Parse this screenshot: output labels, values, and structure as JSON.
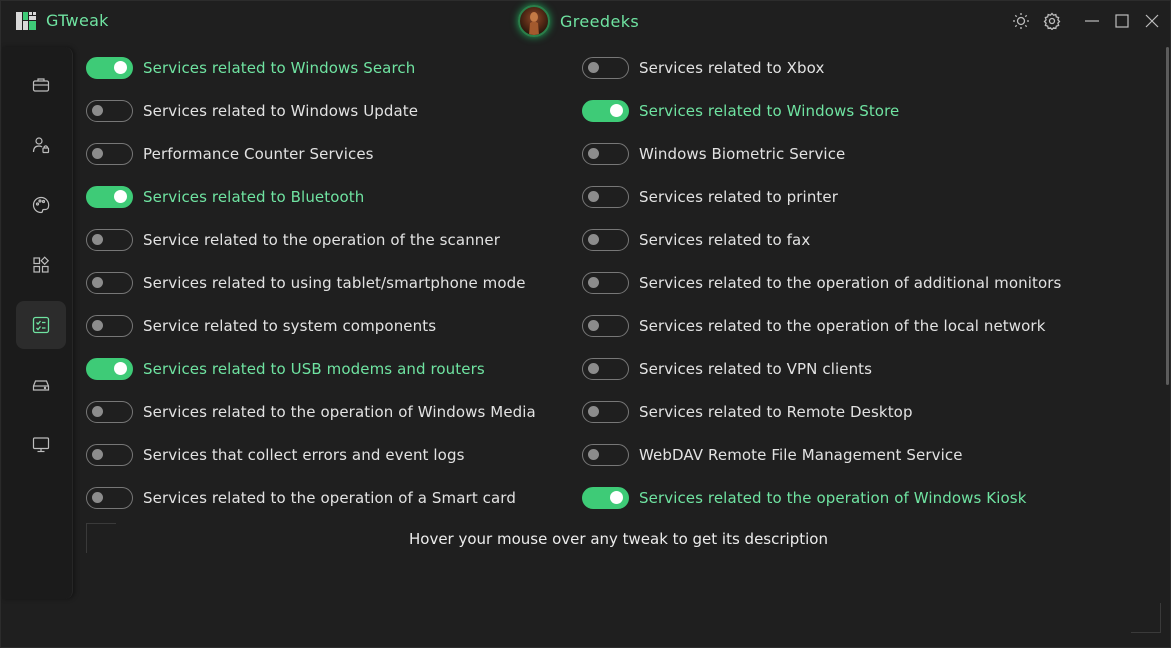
{
  "app": {
    "title": "GTweak",
    "user_name": "Greedeks"
  },
  "title_icons": [
    "sun-icon",
    "gear-icon",
    "minimize-icon",
    "maximize-icon",
    "close-icon"
  ],
  "sidebar": {
    "items": [
      {
        "icon": "briefcase-icon",
        "active": false
      },
      {
        "icon": "user-lock-icon",
        "active": false
      },
      {
        "icon": "palette-icon",
        "active": false
      },
      {
        "icon": "apps-icon",
        "active": false
      },
      {
        "icon": "checklist-icon",
        "active": true
      },
      {
        "icon": "drive-icon",
        "active": false
      },
      {
        "icon": "monitor-icon",
        "active": false
      }
    ]
  },
  "services": {
    "left": [
      {
        "label": "Services related to Windows Search",
        "on": true
      },
      {
        "label": "Services related to Windows Update",
        "on": false
      },
      {
        "label": "Performance Counter Services",
        "on": false
      },
      {
        "label": "Services related to Bluetooth",
        "on": true
      },
      {
        "label": "Service related to the operation of the scanner",
        "on": false
      },
      {
        "label": "Services related to using tablet/smartphone mode",
        "on": false
      },
      {
        "label": "Service related to system components",
        "on": false
      },
      {
        "label": "Services related to USB modems and routers",
        "on": true
      },
      {
        "label": "Services related to the operation of Windows Media",
        "on": false
      },
      {
        "label": "Services that collect errors and event logs",
        "on": false
      },
      {
        "label": "Services related to the operation of a Smart card",
        "on": false
      }
    ],
    "right": [
      {
        "label": "Services related to Xbox",
        "on": false
      },
      {
        "label": "Services related to Windows Store",
        "on": true
      },
      {
        "label": "Windows Biometric Service",
        "on": false
      },
      {
        "label": "Services related to printer",
        "on": false
      },
      {
        "label": "Services related to fax",
        "on": false
      },
      {
        "label": "Services related to the operation of additional monitors",
        "on": false
      },
      {
        "label": "Services related to the operation of the local network",
        "on": false
      },
      {
        "label": "Services related to VPN clients",
        "on": false
      },
      {
        "label": "Services related to Remote Desktop",
        "on": false
      },
      {
        "label": "WebDAV Remote File Management Service",
        "on": false
      },
      {
        "label": "Services related to the operation of Windows Kiosk",
        "on": true
      }
    ]
  },
  "hint": "Hover your mouse over any tweak to get its description",
  "colors": {
    "accent": "#3ecb77",
    "accent_text": "#6fe3a1",
    "background": "#1f1f1f"
  }
}
